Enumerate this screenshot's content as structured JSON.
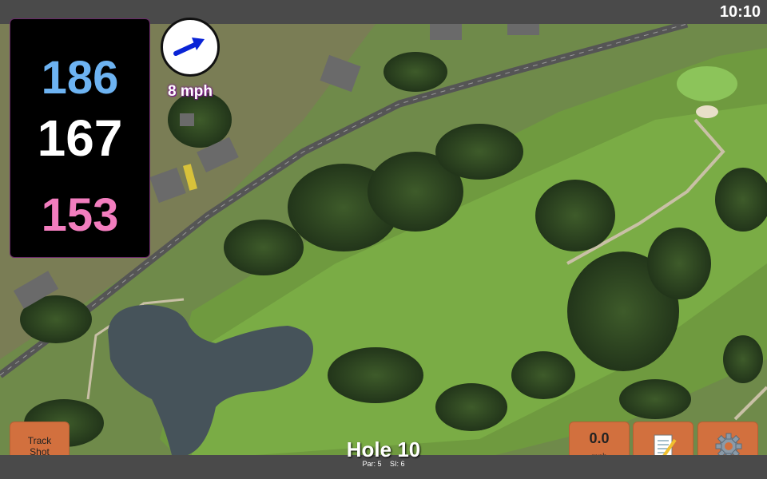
{
  "status": {
    "time": "10:10"
  },
  "distances": {
    "back": "186",
    "middle": "167",
    "front": "153"
  },
  "wind": {
    "speed": "8 mph",
    "icon": "wind-direction-arrow-icon"
  },
  "buttons": {
    "track_shot": "Track\nShot",
    "speed_value": "0.0",
    "speed_unit": "mph",
    "notes_icon": "notepad-icon",
    "settings_icon": "gear-icon"
  },
  "hole": {
    "title": "Hole 10",
    "par": "Par: 5",
    "si": "SI: 6"
  },
  "colors": {
    "back": "#6db3f2",
    "middle": "#ffffff",
    "front": "#f27dbe",
    "button": "#d2703e",
    "bar": "#4a4a4a"
  }
}
